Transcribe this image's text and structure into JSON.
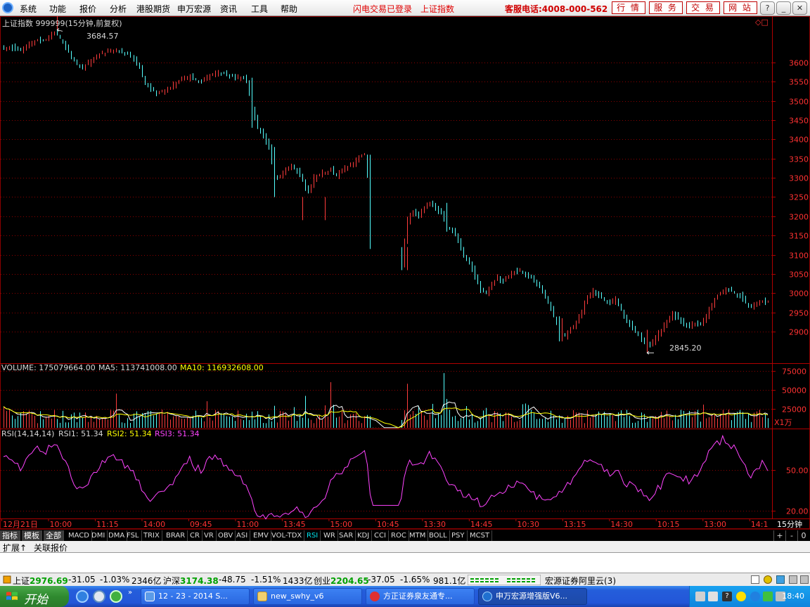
{
  "menu": {
    "items": [
      "系统",
      "功能",
      "报价",
      "分析",
      "港股期货",
      "申万宏源",
      "资讯",
      "工具",
      "帮助"
    ],
    "login_status": "闪电交易已登录",
    "index_name": "上证指数",
    "hotline": "客服电话:4008-000-562",
    "buttons": [
      "行 情",
      "服 务",
      "交 易",
      "网 站"
    ]
  },
  "chart": {
    "title": "上证指数  999999(15分钟,前复权)",
    "high_label": "3684.57",
    "low_label": "2845.20"
  },
  "volume_panel": {
    "vol_label": "VOLUME: 175079664.00",
    "ma5_label": "MA5: 113741008.00",
    "ma10_label": "MA10: 116932608.00",
    "unit": "X1万"
  },
  "rsi_panel": {
    "title": "RSI(14,14,14)",
    "rsi1_label": "RSI1: 51.34",
    "rsi2_label": "RSI2: 51.34",
    "rsi3_label": "RSI3: 51.34"
  },
  "time_axis": {
    "labels": [
      "12月21日",
      "10:00",
      "11:15",
      "14:00",
      "09:45",
      "11:00",
      "13:45",
      "15:00",
      "10:45",
      "13:30",
      "14:45",
      "10:30",
      "13:15",
      "14:30",
      "10:15",
      "13:00",
      "14:1"
    ],
    "period": "15分钟"
  },
  "indicator_tabs": {
    "cn": [
      "指标",
      "模板",
      "全部"
    ],
    "codes": [
      "MACD",
      "DMI",
      "DMA",
      "FSL",
      "TRIX",
      "BRAR",
      "CR",
      "VR",
      "OBV",
      "ASI",
      "EMV",
      "VOL-TDX",
      "RSI",
      "WR",
      "SAR",
      "KDJ",
      "CCI",
      "ROC",
      "MTM",
      "BOLL",
      "PSY",
      "MCST"
    ],
    "active": "RSI",
    "controls": [
      "+",
      "-",
      "0"
    ]
  },
  "sub_tabs": [
    "扩展↑",
    "关联报价"
  ],
  "status": {
    "sh_name": "上证",
    "sh_val": "2976.69",
    "sh_chg": "-31.05",
    "sh_pct": "-1.03%",
    "sh_amt": "2346亿",
    "hs_name": "沪深",
    "hs_val": "3174.38",
    "hs_chg": "-48.75",
    "hs_pct": "-1.51%",
    "hs_amt": "1433亿",
    "cy_name": "创业",
    "cy_val": "2204.65",
    "cy_chg": "-37.05",
    "cy_pct": "-1.65%",
    "cy_amt": "981.1亿",
    "server": "宏源证券阿里云(3)"
  },
  "taskbar": {
    "start": "开始",
    "tasks": [
      "12 - 23 - 2014 S...",
      "new_swhy_v6",
      "方正证券泉友通专...",
      "申万宏源增强版V6..."
    ],
    "clock": "18:40"
  },
  "chart_data": [
    {
      "type": "candlestick",
      "title": "上证指数 999999(15分钟,前复权)",
      "y_ticks": [
        3600,
        3550,
        3500,
        3450,
        3400,
        3350,
        3300,
        3250,
        3200,
        3150,
        3100,
        3050,
        3000,
        2950,
        2900
      ],
      "ylim": [
        2820,
        3700
      ],
      "high": 3684.57,
      "low": 2845.2,
      "x_labels": [
        "12月21日",
        "10:00",
        "11:15",
        "14:00",
        "09:45",
        "11:00",
        "13:45",
        "15:00",
        "10:45",
        "13:30",
        "14:45",
        "10:30",
        "13:15",
        "14:30",
        "10:15",
        "13:00",
        "14:1"
      ],
      "close_path": [
        [
          0,
          3638
        ],
        [
          2,
          3642
        ],
        [
          4,
          3635
        ],
        [
          6,
          3630
        ],
        [
          8,
          3640
        ],
        [
          10,
          3650
        ],
        [
          12,
          3660
        ],
        [
          14,
          3655
        ],
        [
          16,
          3665
        ],
        [
          18,
          3678
        ],
        [
          20,
          3662
        ],
        [
          22,
          3640
        ],
        [
          24,
          3615
        ],
        [
          26,
          3595
        ],
        [
          28,
          3585
        ],
        [
          30,
          3600
        ],
        [
          32,
          3612
        ],
        [
          34,
          3620
        ],
        [
          36,
          3625
        ],
        [
          38,
          3630
        ],
        [
          40,
          3632
        ],
        [
          42,
          3628
        ],
        [
          44,
          3622
        ],
        [
          46,
          3610
        ],
        [
          48,
          3585
        ],
        [
          50,
          3545
        ],
        [
          52,
          3530
        ],
        [
          54,
          3520
        ],
        [
          56,
          3525
        ],
        [
          58,
          3530
        ],
        [
          60,
          3542
        ],
        [
          62,
          3552
        ],
        [
          64,
          3560
        ],
        [
          66,
          3562
        ],
        [
          68,
          3555
        ],
        [
          70,
          3550
        ],
        [
          72,
          3560
        ],
        [
          74,
          3570
        ],
        [
          76,
          3575
        ],
        [
          78,
          3570
        ],
        [
          80,
          3565
        ],
        [
          82,
          3560
        ],
        [
          84,
          3563
        ],
        [
          86,
          3555
        ],
        [
          88,
          3480
        ],
        [
          90,
          3430
        ],
        [
          92,
          3410
        ],
        [
          94,
          3380
        ],
        [
          96,
          3300
        ],
        [
          98,
          3300
        ],
        [
          100,
          3320
        ],
        [
          102,
          3330
        ],
        [
          104,
          3320
        ],
        [
          106,
          3290
        ],
        [
          108,
          3260
        ],
        [
          110,
          3300
        ],
        [
          112,
          3310
        ],
        [
          114,
          3315
        ],
        [
          116,
          3320
        ],
        [
          118,
          3305
        ],
        [
          120,
          3320
        ],
        [
          122,
          3330
        ],
        [
          124,
          3340
        ],
        [
          126,
          3355
        ],
        [
          128,
          3360
        ],
        [
          129,
          3300
        ],
        [
          130,
          3200
        ],
        [
          131,
          3115
        ],
        [
          134,
          3115
        ],
        [
          138,
          3115
        ],
        [
          140,
          3115
        ],
        [
          141,
          3080
        ],
        [
          143,
          3190
        ],
        [
          145,
          3210
        ],
        [
          147,
          3200
        ],
        [
          149,
          3220
        ],
        [
          151,
          3235
        ],
        [
          153,
          3220
        ],
        [
          155,
          3210
        ],
        [
          157,
          3170
        ],
        [
          159,
          3160
        ],
        [
          161,
          3140
        ],
        [
          163,
          3100
        ],
        [
          165,
          3080
        ],
        [
          167,
          3040
        ],
        [
          169,
          3010
        ],
        [
          171,
          3000
        ],
        [
          173,
          3025
        ],
        [
          175,
          3040
        ],
        [
          177,
          3030
        ],
        [
          179,
          3045
        ],
        [
          181,
          3055
        ],
        [
          183,
          3060
        ],
        [
          185,
          3050
        ],
        [
          187,
          3040
        ],
        [
          189,
          3025
        ],
        [
          191,
          3005
        ],
        [
          193,
          2975
        ],
        [
          195,
          2940
        ],
        [
          197,
          2895
        ],
        [
          199,
          2890
        ],
        [
          201,
          2910
        ],
        [
          203,
          2925
        ],
        [
          205,
          2955
        ],
        [
          207,
          2990
        ],
        [
          209,
          3005
        ],
        [
          211,
          2995
        ],
        [
          213,
          2980
        ],
        [
          215,
          2975
        ],
        [
          217,
          2985
        ],
        [
          219,
          2955
        ],
        [
          221,
          2925
        ],
        [
          223,
          2910
        ],
        [
          225,
          2895
        ],
        [
          227,
          2870
        ],
        [
          229,
          2865
        ],
        [
          231,
          2885
        ],
        [
          233,
          2905
        ],
        [
          235,
          2925
        ],
        [
          237,
          2945
        ],
        [
          239,
          2935
        ],
        [
          241,
          2920
        ],
        [
          243,
          2915
        ],
        [
          245,
          2920
        ],
        [
          247,
          2918
        ],
        [
          249,
          2940
        ],
        [
          251,
          2970
        ],
        [
          253,
          2995
        ],
        [
          255,
          3005
        ],
        [
          257,
          3010
        ],
        [
          259,
          3000
        ],
        [
          261,
          2995
        ],
        [
          263,
          2975
        ],
        [
          265,
          2965
        ],
        [
          267,
          2970
        ],
        [
          269,
          2980
        ],
        [
          271,
          2978
        ]
      ]
    },
    {
      "type": "bar",
      "title": "VOLUME",
      "y_ticks": [
        75000,
        50000,
        25000
      ],
      "ylim": [
        0,
        85000
      ],
      "unit": "X1万",
      "spikes": [
        [
          0,
          28000
        ],
        [
          40,
          45000
        ],
        [
          72,
          35000
        ],
        [
          107,
          42000
        ],
        [
          116,
          60000
        ],
        [
          143,
          58000
        ],
        [
          156,
          72000
        ],
        [
          157,
          38000
        ],
        [
          185,
          32000
        ]
      ]
    },
    {
      "type": "line",
      "title": "RSI(14,14,14)",
      "y_ticks": [
        50.0,
        20.0
      ],
      "ylim": [
        15,
        80
      ],
      "rsi_path": [
        [
          0,
          62
        ],
        [
          2,
          58
        ],
        [
          4,
          55
        ],
        [
          6,
          51
        ],
        [
          8,
          56
        ],
        [
          10,
          64
        ],
        [
          12,
          68
        ],
        [
          14,
          62
        ],
        [
          16,
          66
        ],
        [
          18,
          70
        ],
        [
          20,
          63
        ],
        [
          22,
          55
        ],
        [
          24,
          46
        ],
        [
          26,
          38
        ],
        [
          28,
          35
        ],
        [
          30,
          41
        ],
        [
          32,
          48
        ],
        [
          34,
          53
        ],
        [
          36,
          57
        ],
        [
          38,
          59
        ],
        [
          40,
          60
        ],
        [
          42,
          56
        ],
        [
          44,
          52
        ],
        [
          46,
          48
        ],
        [
          48,
          40
        ],
        [
          50,
          30
        ],
        [
          52,
          28
        ],
        [
          54,
          30
        ],
        [
          56,
          33
        ],
        [
          58,
          36
        ],
        [
          60,
          42
        ],
        [
          62,
          48
        ],
        [
          64,
          54
        ],
        [
          66,
          57
        ],
        [
          68,
          52
        ],
        [
          70,
          50
        ],
        [
          72,
          56
        ],
        [
          74,
          60
        ],
        [
          76,
          58
        ],
        [
          78,
          55
        ],
        [
          80,
          52
        ],
        [
          82,
          47
        ],
        [
          84,
          46
        ],
        [
          86,
          36
        ],
        [
          88,
          26
        ],
        [
          90,
          19
        ],
        [
          92,
          18
        ],
        [
          94,
          16
        ],
        [
          96,
          16
        ],
        [
          98,
          14
        ],
        [
          100,
          16
        ],
        [
          102,
          18
        ],
        [
          104,
          20
        ],
        [
          106,
          17
        ],
        [
          108,
          16
        ],
        [
          110,
          22
        ],
        [
          112,
          26
        ],
        [
          114,
          30
        ],
        [
          116,
          40
        ],
        [
          118,
          48
        ],
        [
          120,
          50
        ],
        [
          122,
          54
        ],
        [
          124,
          56
        ],
        [
          126,
          60
        ],
        [
          128,
          64
        ],
        [
          129,
          54
        ],
        [
          130,
          34
        ],
        [
          131,
          24
        ],
        [
          134,
          24
        ],
        [
          138,
          24
        ],
        [
          140,
          24
        ],
        [
          141,
          32
        ],
        [
          143,
          54
        ],
        [
          145,
          56
        ],
        [
          147,
          52
        ],
        [
          149,
          56
        ],
        [
          151,
          62
        ],
        [
          153,
          58
        ],
        [
          155,
          54
        ],
        [
          157,
          44
        ],
        [
          159,
          40
        ],
        [
          161,
          36
        ],
        [
          163,
          30
        ],
        [
          165,
          30
        ],
        [
          167,
          28
        ],
        [
          169,
          26
        ],
        [
          171,
          24
        ],
        [
          173,
          30
        ],
        [
          175,
          35
        ],
        [
          177,
          32
        ],
        [
          179,
          36
        ],
        [
          181,
          40
        ],
        [
          183,
          42
        ],
        [
          185,
          38
        ],
        [
          187,
          33
        ],
        [
          189,
          30
        ],
        [
          191,
          28
        ],
        [
          193,
          26
        ],
        [
          195,
          28
        ],
        [
          197,
          34
        ],
        [
          199,
          36
        ],
        [
          201,
          40
        ],
        [
          203,
          46
        ],
        [
          205,
          52
        ],
        [
          207,
          56
        ],
        [
          209,
          58
        ],
        [
          211,
          54
        ],
        [
          213,
          50
        ],
        [
          215,
          48
        ],
        [
          217,
          50
        ],
        [
          219,
          44
        ],
        [
          221,
          40
        ],
        [
          223,
          38
        ],
        [
          225,
          36
        ],
        [
          227,
          32
        ],
        [
          229,
          30
        ],
        [
          231,
          34
        ],
        [
          233,
          38
        ],
        [
          235,
          44
        ],
        [
          237,
          48
        ],
        [
          239,
          46
        ],
        [
          241,
          44
        ],
        [
          243,
          42
        ],
        [
          245,
          46
        ],
        [
          247,
          50
        ],
        [
          249,
          58
        ],
        [
          251,
          64
        ],
        [
          253,
          70
        ],
        [
          255,
          72
        ],
        [
          257,
          68
        ],
        [
          259,
          66
        ],
        [
          261,
          60
        ],
        [
          263,
          52
        ],
        [
          265,
          46
        ],
        [
          267,
          48
        ],
        [
          269,
          54
        ],
        [
          271,
          52
        ]
      ]
    }
  ]
}
